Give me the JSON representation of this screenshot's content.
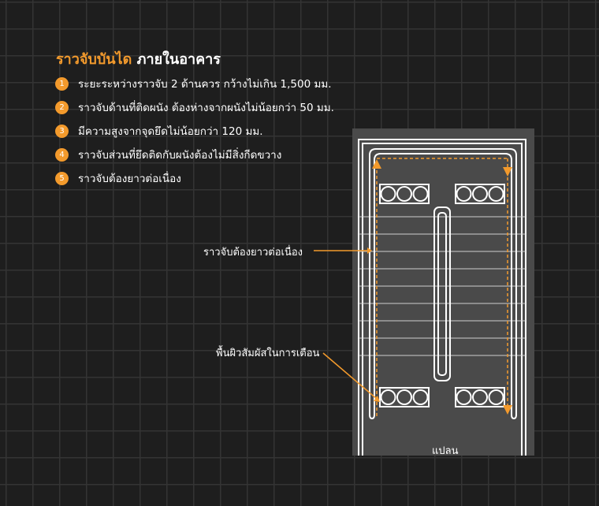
{
  "title": {
    "accent": "ราวจับบันได",
    "rest": "ภายในอาคาร"
  },
  "items": [
    {
      "number": "1",
      "text": "ระยะระหว่างราวจับ 2 ด้านควร กว้างไม่เกิน 1,500 มม."
    },
    {
      "number": "2",
      "text": "ราวจับด้านที่ติดผนัง ต้องห่างจากผนังไม่น้อยกว่า 50 มม."
    },
    {
      "number": "3",
      "text": "มีความสูงจากจุดยึดไม่น้อยกว่า 120 มม."
    },
    {
      "number": "4",
      "text": "ราวจับส่วนที่ยึดติดกับผนังต้องไม่มีสิ่งกีดขวาง"
    },
    {
      "number": "5",
      "text": "ราวจับต้องยาวต่อเนื่อง"
    }
  ],
  "callouts": {
    "continuous_rail": "ราวจับต้องยาวต่อเนื่อง",
    "warning_surface": "พื้นผิวสัมผัสในการเตือน"
  },
  "plan_label": "แปลน",
  "colors": {
    "accent": "#f39a2c",
    "background": "#1e1e1e",
    "grid": "#343434",
    "plan_fill": "#4a4a4a",
    "line": "#ffffff"
  }
}
